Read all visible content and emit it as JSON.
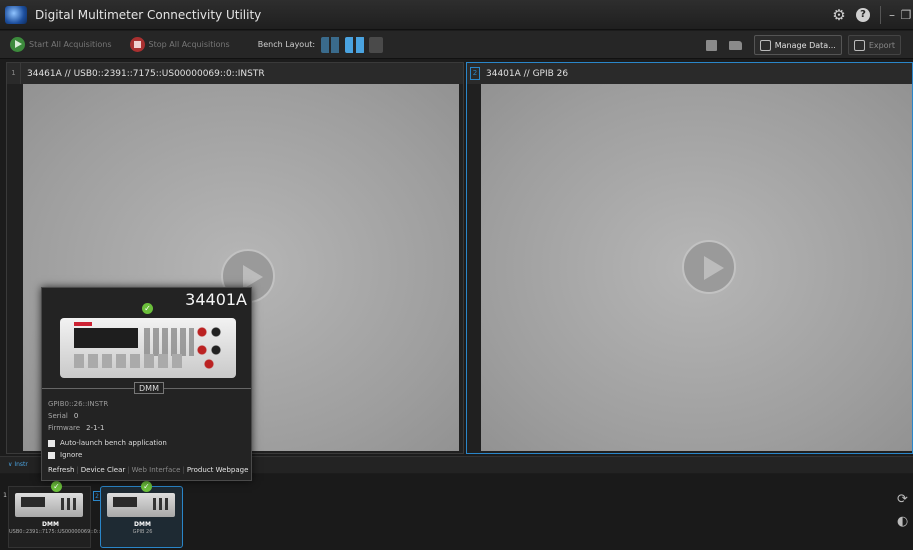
{
  "app": {
    "title": "Digital Multimeter Connectivity Utility",
    "settings_glyph": "⚙",
    "help_glyph": "?",
    "minimize_glyph": "–",
    "restore_glyph": "❐"
  },
  "toolbar": {
    "start_label": "Start All Acquisitions",
    "stop_label": "Stop All Acquisitions",
    "bench_layout_label": "Bench Layout:",
    "manage_data_label": "Manage Data...",
    "export_label": "Export"
  },
  "panels": [
    {
      "index": "1",
      "title": "34461A // USB0::2391::7175::US00000069::0::INSTR"
    },
    {
      "index": "2",
      "title": "34401A // GPIB 26"
    }
  ],
  "instrument_bar": {
    "toggle_glyph": "∨",
    "toggle_label": "Instr"
  },
  "instruments": [
    {
      "index": "1",
      "label": "DMM",
      "address": "USB0::2391::7175::US00000069::0::IN"
    },
    {
      "index": "2",
      "label": "DMM",
      "address": "GPIB 26"
    }
  ],
  "popup": {
    "model": "34401A",
    "type_label": "DMM",
    "address": "GPIB0::26::INSTR",
    "serial_label": "Serial",
    "serial_value": "0",
    "firmware_label": "Firmware",
    "firmware_value": "2-1-1",
    "auto_launch_label": "Auto-launch bench application",
    "ignore_label": "Ignore",
    "links": {
      "refresh": "Refresh",
      "device_clear": "Device Clear",
      "web_interface": "Web Interface",
      "product_webpage": "Product Webpage"
    }
  },
  "side_icons": {
    "refresh_glyph": "⟳",
    "io_glyph": "◐"
  },
  "colors": {
    "accent": "#2a86c9",
    "ok": "#6bbf3b",
    "start": "#3c8a3c",
    "stop": "#a93030"
  }
}
